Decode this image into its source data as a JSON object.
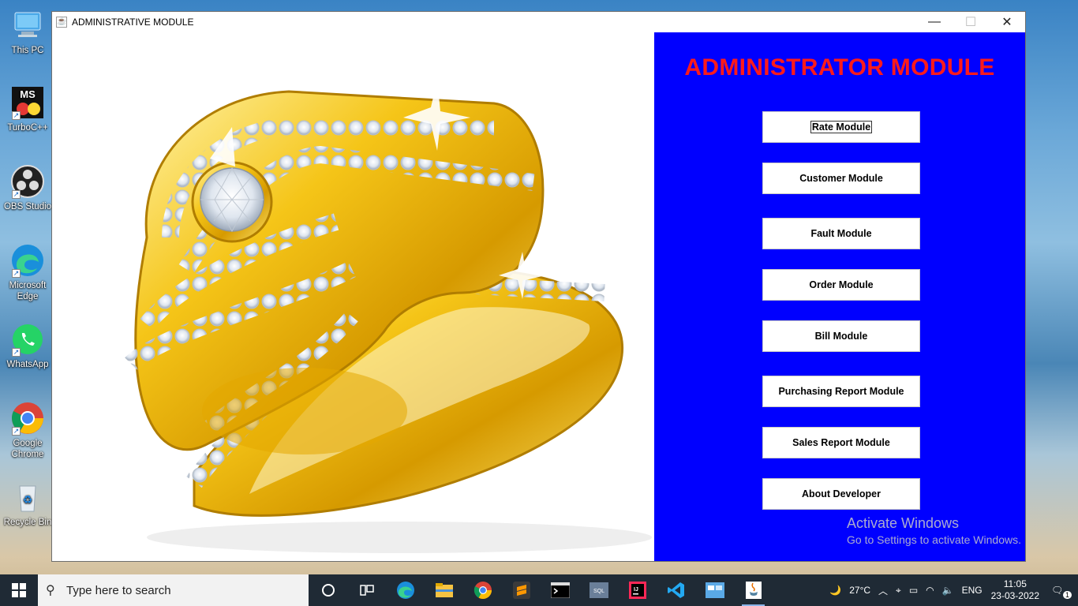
{
  "desktop": {
    "icons": [
      {
        "label": "This PC"
      },
      {
        "label": "TurboC++"
      },
      {
        "label": "OBS Studio"
      },
      {
        "label": "Microsoft Edge"
      },
      {
        "label": "WhatsApp"
      },
      {
        "label": "Google Chrome"
      },
      {
        "label": "Recycle Bin"
      }
    ]
  },
  "window": {
    "title": "ADMINISTRATIVE MODULE",
    "controls": {
      "minimize": "—",
      "maximize": "☐",
      "close": "✕"
    }
  },
  "panel": {
    "heading": "ADMINISTRATOR MODULE",
    "buttons": [
      {
        "label": "Rate Module"
      },
      {
        "label": "Customer Module"
      },
      {
        "label": "Fault Module"
      },
      {
        "label": "Order Module"
      },
      {
        "label": "Bill Module"
      },
      {
        "label": "Purchasing Report Module"
      },
      {
        "label": "Sales Report Module"
      },
      {
        "label": "About Developer"
      }
    ]
  },
  "watermark": {
    "line1": "Activate Windows",
    "line2": "Go to Settings to activate Windows."
  },
  "taskbar": {
    "search_placeholder": "Type here to search",
    "weather": "27°C",
    "language": "ENG",
    "time": "11:05",
    "date": "23-03-2022",
    "notification_count": "1"
  },
  "colors": {
    "panel_background": "#0000ff",
    "heading_color": "#ff1a1a",
    "taskbar": "#1f2a35"
  }
}
